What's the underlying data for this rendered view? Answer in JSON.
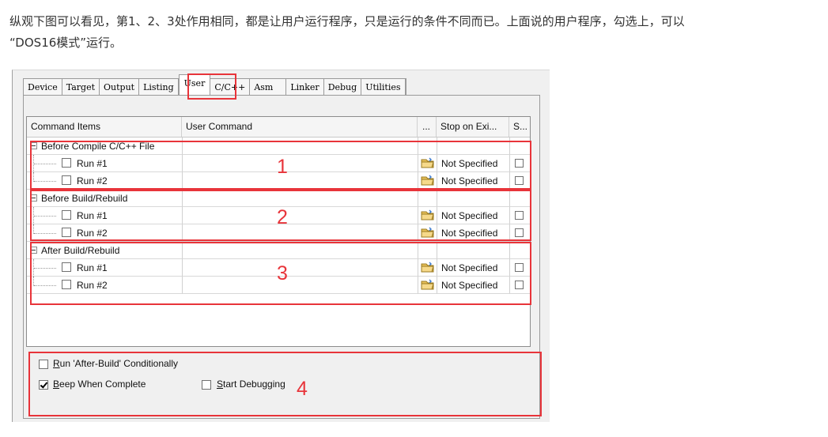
{
  "article": {
    "line1": "纵观下图可以看见，第1、2、3处作用相同，都是让用户运行程序，只是运行的条件不同而已。上面说的用户程序，勾选上，可以",
    "line2": "“DOS16模式”运行。"
  },
  "tabs": [
    {
      "label": "Device"
    },
    {
      "label": "Target"
    },
    {
      "label": "Output"
    },
    {
      "label": "Listing"
    },
    {
      "label": "User",
      "active": true
    },
    {
      "label": "C/C++"
    },
    {
      "label": "Asm"
    },
    {
      "label": "Linker"
    },
    {
      "label": "Debug"
    },
    {
      "label": "Utilities"
    }
  ],
  "grid": {
    "columns": [
      "Command Items",
      "User Command",
      "...",
      "Stop on Exi...",
      "S..."
    ],
    "groups": [
      {
        "title": "Before Compile C/C++ File",
        "runs": [
          {
            "label": "Run #1",
            "command": "",
            "stop": "Not Specified"
          },
          {
            "label": "Run #2",
            "command": "",
            "stop": "Not Specified"
          }
        ]
      },
      {
        "title": "Before Build/Rebuild",
        "runs": [
          {
            "label": "Run #1",
            "command": "",
            "stop": "Not Specified"
          },
          {
            "label": "Run #2",
            "command": "",
            "stop": "Not Specified"
          }
        ]
      },
      {
        "title": "After Build/Rebuild",
        "runs": [
          {
            "label": "Run #1",
            "command": "",
            "stop": "Not Specified"
          },
          {
            "label": "Run #2",
            "command": "",
            "stop": "Not Specified"
          }
        ]
      }
    ]
  },
  "options": {
    "run_after_build": {
      "label_first": "R",
      "label_rest": "un 'After-Build' Conditionally",
      "checked": false
    },
    "beep": {
      "label_first": "B",
      "label_rest": "eep When Complete",
      "checked": true
    },
    "start_debugging": {
      "label_first": "S",
      "label_rest": "tart Debugging",
      "checked": false
    }
  },
  "annotations": {
    "n1": "1",
    "n2": "2",
    "n3": "3",
    "n4": "4",
    "color": "#e8343a"
  }
}
